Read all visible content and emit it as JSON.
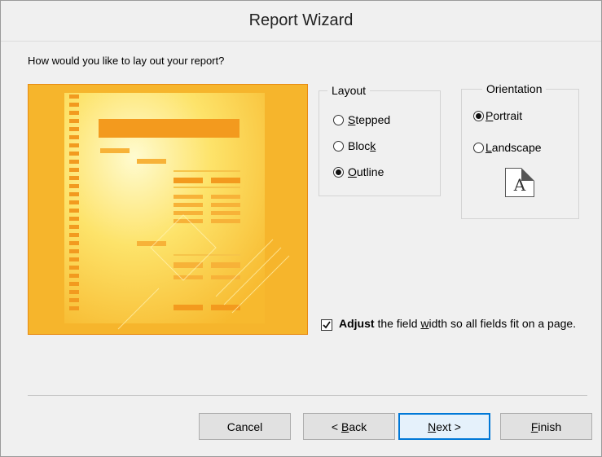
{
  "window": {
    "title": "Report Wizard"
  },
  "question": "How would you like to lay out your report?",
  "layout_group": {
    "title": "Layout",
    "options": [
      {
        "pre": "",
        "key": "S",
        "post": "tepped",
        "checked": false
      },
      {
        "pre": "Bloc",
        "key": "k",
        "post": "",
        "checked": false
      },
      {
        "pre": "",
        "key": "O",
        "post": "utline",
        "checked": true
      }
    ]
  },
  "orientation_group": {
    "title": "Orientation",
    "options": [
      {
        "pre": "",
        "key": "P",
        "post": "ortrait",
        "checked": true
      },
      {
        "pre": "",
        "key": "L",
        "post": "andscape",
        "checked": false
      }
    ],
    "icon_letter": "A"
  },
  "adjust_checkbox": {
    "checked": true,
    "bold_text": "Adjust",
    "text_before_key": " the field ",
    "key_text": "w",
    "text_after_key": "idth so all fields fit on a page."
  },
  "buttons": {
    "cancel": {
      "label": "Cancel"
    },
    "back": {
      "pre": "< ",
      "key": "B",
      "post": "ack"
    },
    "next": {
      "pre": "",
      "key": "N",
      "post": "ext >"
    },
    "finish": {
      "pre": "",
      "key": "F",
      "post": "inish"
    }
  },
  "colors": {
    "preview_orange": "#f6b52c",
    "preview_light": "#fff6a8",
    "preview_bar": "#f39a1e",
    "accent_blue": "#0078d7"
  }
}
